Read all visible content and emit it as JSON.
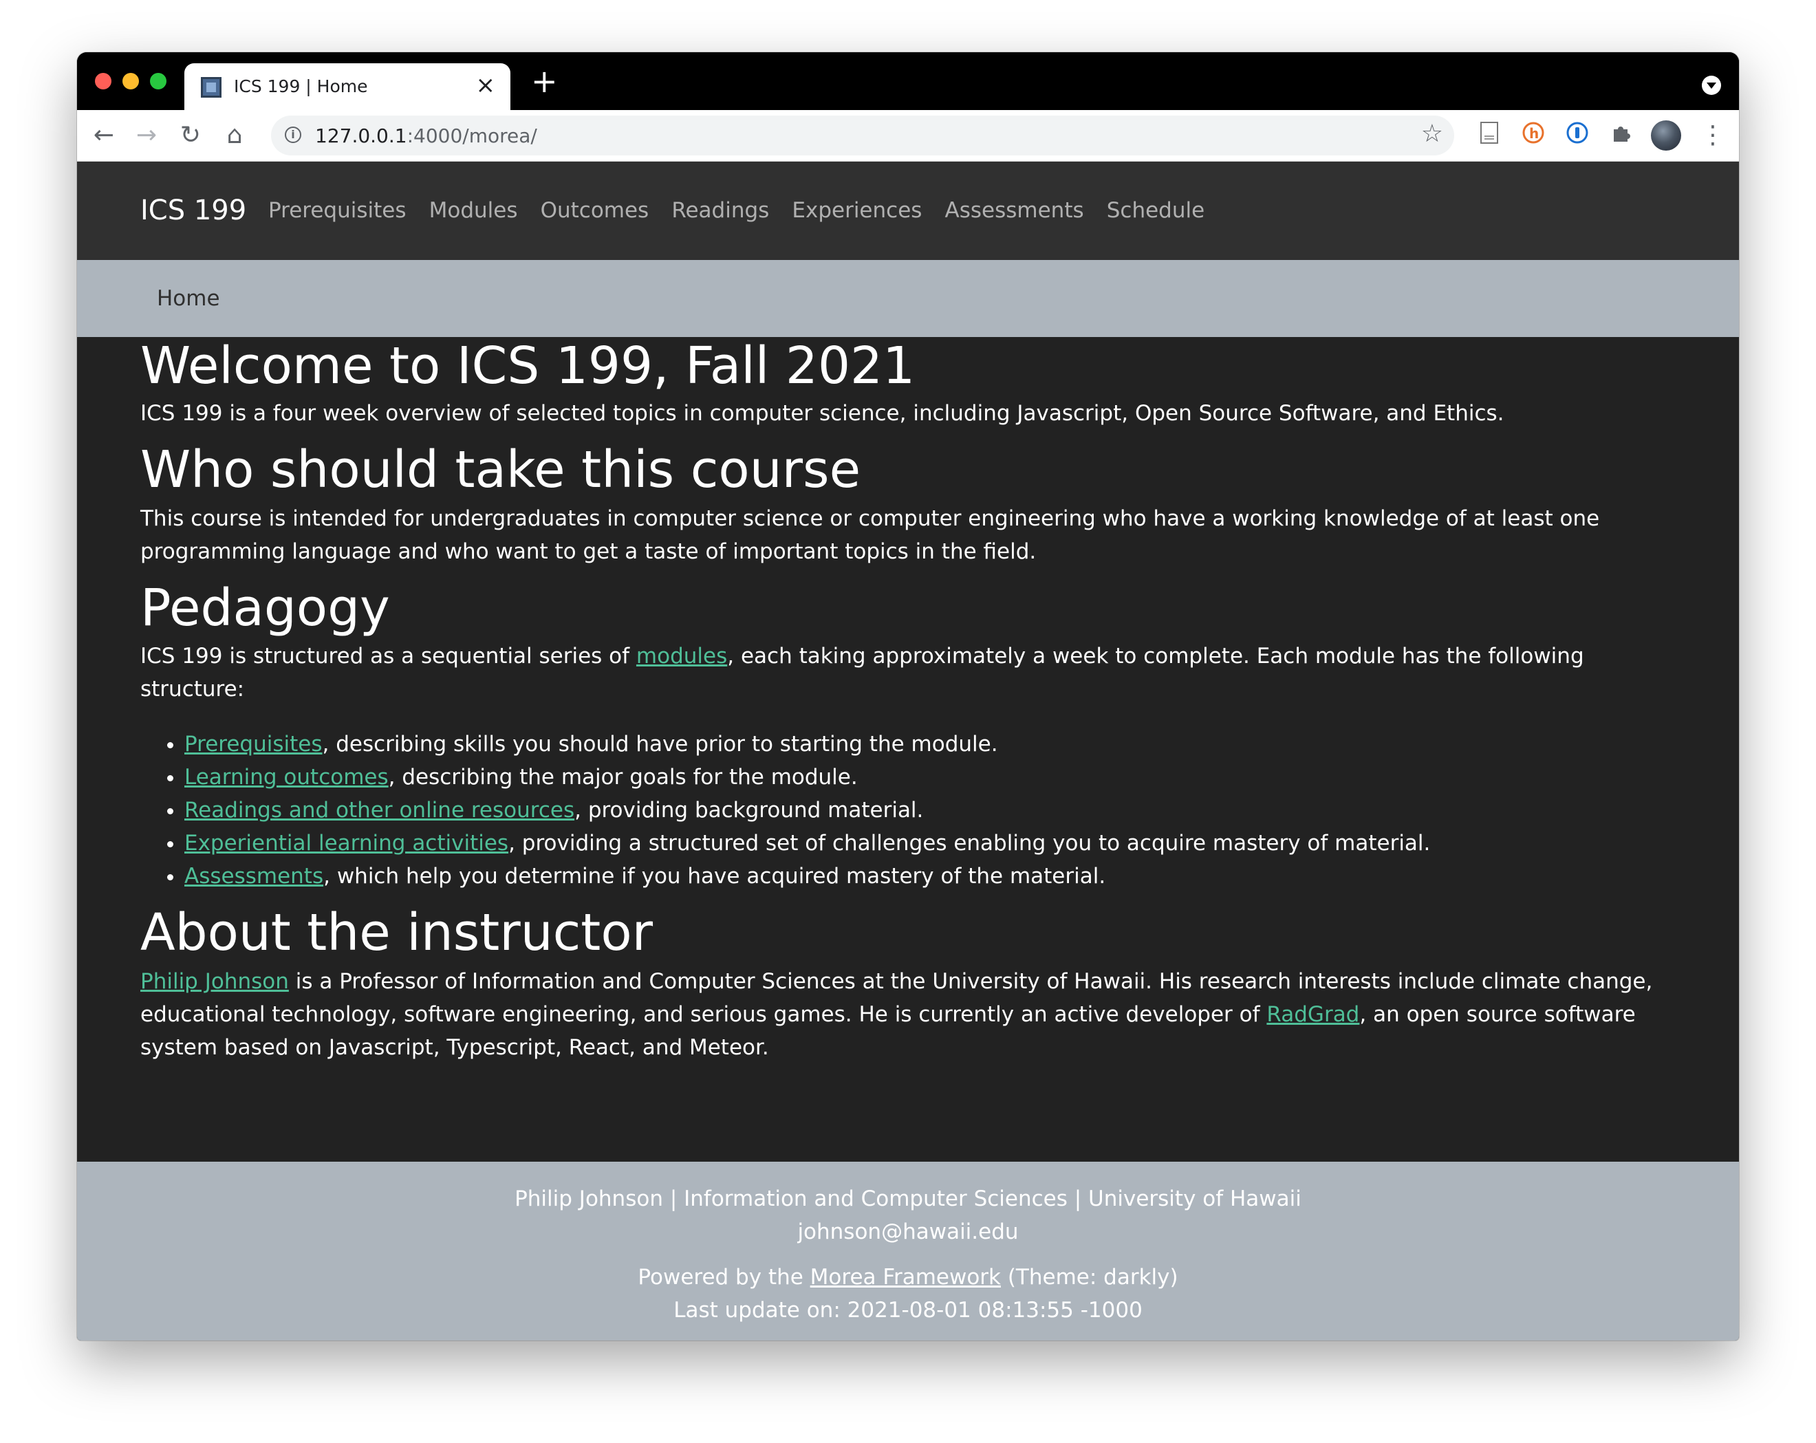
{
  "browser": {
    "tab_title": "ICS 199 | Home",
    "tab_close": "×",
    "new_tab": "+",
    "url_host": "127.0.0.1",
    "url_path": ":4000/morea/",
    "icons": {
      "back": "←",
      "forward": "→",
      "reload": "↻",
      "home": "⌂",
      "star": "☆",
      "info": "i",
      "kebab": "⋮"
    },
    "extension_icons": [
      "document-icon",
      "honey-icon",
      "password-manager-icon",
      "puzzle-icon"
    ]
  },
  "navbar": {
    "brand": "ICS 199",
    "links": [
      "Prerequisites",
      "Modules",
      "Outcomes",
      "Readings",
      "Experiences",
      "Assessments",
      "Schedule"
    ]
  },
  "breadcrumb": "Home",
  "content": {
    "welcome": {
      "title": "Welcome to ICS 199, Fall 2021",
      "text": "ICS 199 is a four week overview of selected topics in computer science, including Javascript, Open Source Software, and Ethics."
    },
    "who": {
      "title": "Who should take this course",
      "text": "This course is intended for undergraduates in computer science or computer engineering who have a working knowledge of at least one programming language and who want to get a taste of important topics in the field."
    },
    "pedagogy": {
      "title": "Pedagogy",
      "intro_before": "ICS 199 is structured as a sequential series of ",
      "intro_link": "modules",
      "intro_after": ", each taking approximately a week to complete. Each module has the following structure:",
      "items": [
        {
          "link": "Prerequisites",
          "text": ", describing skills you should have prior to starting the module."
        },
        {
          "link": "Learning outcomes",
          "text": ", describing the major goals for the module."
        },
        {
          "link": "Readings and other online resources",
          "text": ", providing background material."
        },
        {
          "link": "Experiential learning activities",
          "text": ", providing a structured set of challenges enabling you to acquire mastery of material."
        },
        {
          "link": "Assessments",
          "text": ", which help you determine if you have acquired mastery of the material."
        }
      ]
    },
    "instructor": {
      "title": "About the instructor",
      "name_link": "Philip Johnson",
      "text_1": " is a Professor of Information and Computer Sciences at the University of Hawaii. His research interests include climate change, educational technology, software engineering, and serious games. He is currently an active developer of ",
      "radgrad_link": "RadGrad",
      "text_2": ", an open source software system based on Javascript, Typescript, React, and Meteor."
    }
  },
  "footer": {
    "line1": "Philip Johnson | Information and Computer Sciences | University of Hawaii",
    "line2": "johnson@hawaii.edu",
    "powered_before": "Powered by the ",
    "powered_link": "Morea Framework",
    "powered_after": " (Theme: darkly)",
    "last_update": "Last update on: 2021-08-01 08:13:55 -1000"
  },
  "colors": {
    "page_bg": "#222222",
    "navbar_bg": "#303030",
    "breadcrumb_bg": "#adb5bd",
    "link": "#4fbf98"
  }
}
